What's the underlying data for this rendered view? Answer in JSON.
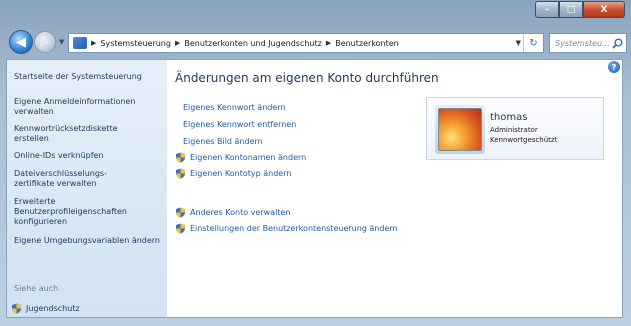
{
  "caption": {
    "minimize": "–",
    "maximize": "□",
    "close": "X"
  },
  "nav": {
    "back_glyph": "◀",
    "forward_glyph": "▶",
    "breadcrumbs": [
      "Systemsteuerung",
      "Benutzerkonten und Jugendschutz",
      "Benutzerkonten"
    ],
    "refresh_glyph": "↻",
    "search_placeholder": "Systemsteu..."
  },
  "sidebar": {
    "home": "Startseite der Systemsteuerung",
    "links": [
      "Eigene Anmeldeinformationen verwalten",
      "Kennwortrücksetzdiskette erstellen",
      "Online-IDs verknüpfen",
      "Dateiverschlüsselungs-zertifikate verwalten",
      "Erweiterte Benutzerprofileigenschaften konfigurieren",
      "Eigene Umgebungsvariablen ändern"
    ],
    "see_also": "Siehe auch",
    "jugendschutz": "Jugendschutz"
  },
  "main": {
    "heading": "Änderungen am eigenen Konto durchführen",
    "tasks_plain": [
      "Eigenes Kennwort ändern",
      "Eigenes Kennwort entfernen",
      "Eigenes Bild ändern"
    ],
    "tasks_shield": [
      "Eigenen Kontonamen ändern",
      "Eigenen Kontotyp ändern"
    ],
    "tasks_other": [
      "Anderes Konto verwalten",
      "Einstellungen der Benutzerkontensteuerung ändern"
    ],
    "help": "?"
  },
  "account": {
    "name": "thomas",
    "role": "Administrator",
    "status": "Kennwortgeschützt"
  }
}
